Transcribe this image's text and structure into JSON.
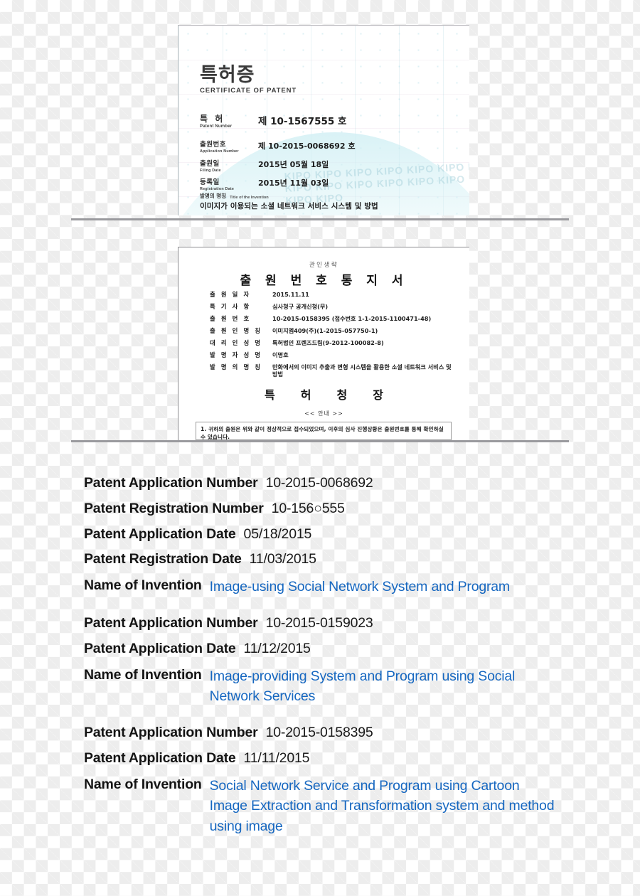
{
  "certificate": {
    "title_ko": "특허증",
    "title_en": "CERTIFICATE OF PATENT",
    "ribbon_color": "#2f5d93",
    "seal_name": "gold-patent-seal",
    "watermark_text": "KIPO KIPO KIPO KIPO KIPO KIPO KIPO KIPO KIPO KIPO KIPO KIPO KIPO KIPO KIPO KIPO",
    "rows": [
      {
        "label_ko": "특 허",
        "label_en": "Patent Number",
        "value": "제 10-1567555 호"
      },
      {
        "label_ko": "출원번호",
        "label_en": "Application Number",
        "value": "제 10-2015-0068692 호"
      },
      {
        "label_ko": "출원일",
        "label_en": "Filing Date",
        "value": "2015년  05월  18일"
      },
      {
        "label_ko": "등록일",
        "label_en": "Registration Date",
        "value": "2015년  11월  03일"
      }
    ],
    "invention_label_ko": "발명의 명칭",
    "invention_label_en": "Title of the Invention",
    "invention_title": "이미지가 이용되는 소셜 네트워크 서비스 시스템 및 방법"
  },
  "notice": {
    "stamp_note": "관인생략",
    "heading": "출 원 번 호 통 지 서",
    "fields": [
      {
        "label": "출 원 일 자",
        "value": "2015.11.11"
      },
      {
        "label": "특 기 사 항",
        "value": "심사청구  공개신청(무)"
      },
      {
        "label": "출 원 번 호",
        "value": "10-2015-0158395 (접수번호 1-1-2015-1100471-48)"
      },
      {
        "label": "출 원 인 명 칭",
        "value": "이미지엠409(주)(1-2015-057750-1)"
      },
      {
        "label": "대 리 인 성 명",
        "value": "특허법인 프렌즈드림(9-2012-100082-8)"
      },
      {
        "label": "발 명 자 성 명",
        "value": "이명호"
      },
      {
        "label": "발 명 의 명 칭",
        "value": "만화에서의 이미지 추출과 변형 시스템을 활용한 소셜 네트워크 서비스 및 방법"
      }
    ],
    "office": "특허청장",
    "guide_marker": "<< 안내 >>",
    "guide_text": "1. 귀하의 출원은 위와 같이 정상적으로 접수되었으며, 이후의 심사 진행상황은 출원번호를 통해 확인하실 수 있습니다."
  },
  "summary": {
    "accent_color": "#1667c0",
    "groups": [
      {
        "rows": [
          {
            "label": "Patent Application Number",
            "value": "10-2015-0068692",
            "accent": false
          },
          {
            "label": "Patent Registration Number",
            "value": "10-156○555",
            "accent": false
          },
          {
            "label": "Patent Application Date",
            "value": "05/18/2015",
            "accent": false
          },
          {
            "label": "Patent Registration Date",
            "value": "11/03/2015",
            "accent": false
          },
          {
            "label": "Name of Invention",
            "value": "Image-using Social Network System and Program",
            "accent": true
          }
        ]
      },
      {
        "rows": [
          {
            "label": "Patent Application Number",
            "value": "10-2015-0159023",
            "accent": false
          },
          {
            "label": "Patent Application Date",
            "value": "11/12/2015",
            "accent": false
          },
          {
            "label": "Name of Invention",
            "value": "Image-providing System and Program using Social Network Services",
            "accent": true
          }
        ]
      },
      {
        "rows": [
          {
            "label": "Patent Application Number",
            "value": "10-2015-0158395",
            "accent": false
          },
          {
            "label": "Patent Application Date",
            "value": "11/11/2015",
            "accent": false
          },
          {
            "label": "Name of Invention",
            "value": "Social Network Service and Program using Cartoon Image Extraction and Transformation system and method using image",
            "accent": true
          }
        ]
      }
    ]
  }
}
